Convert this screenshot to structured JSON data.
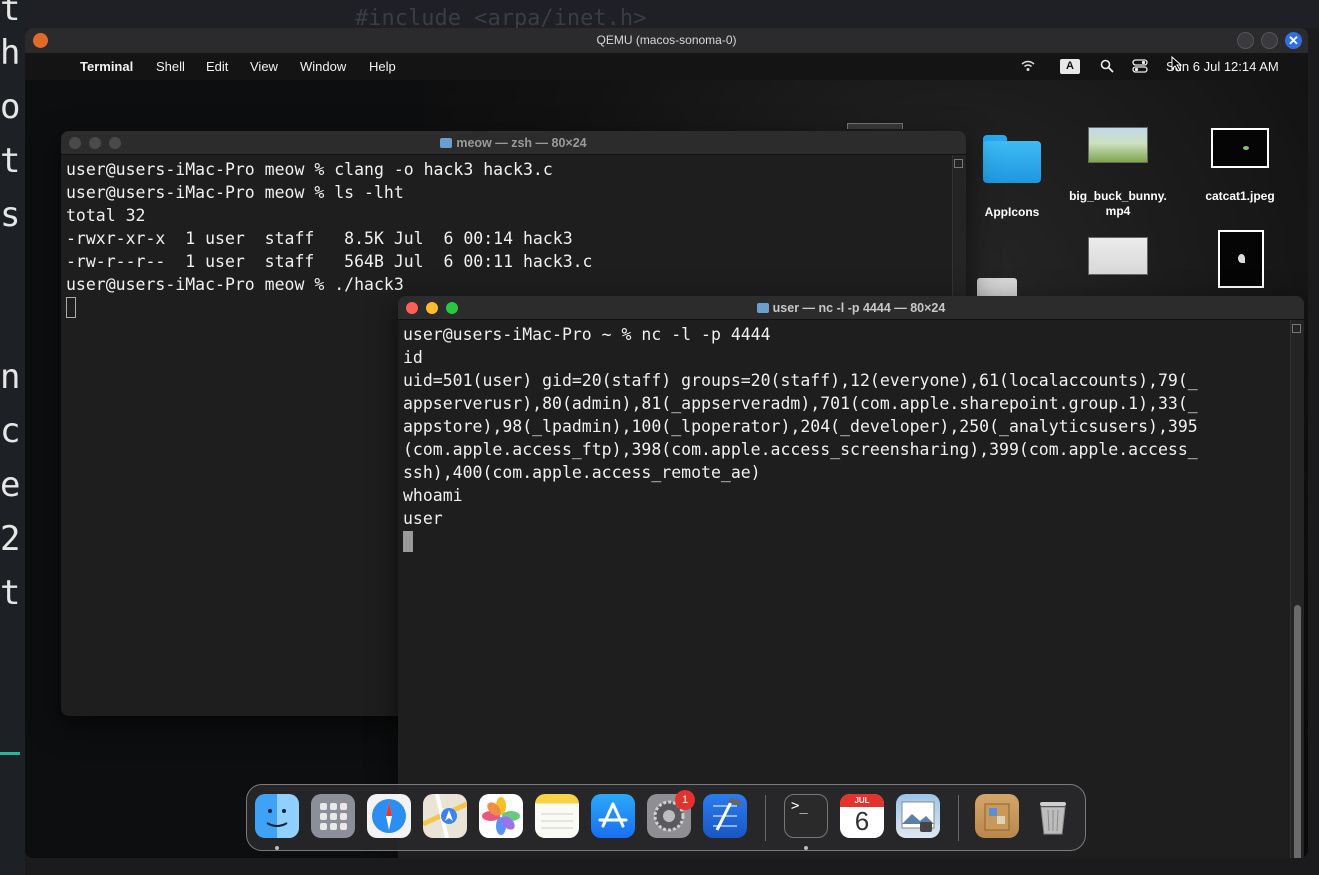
{
  "host": {
    "left_letters": [
      "t",
      "h",
      "o",
      "t",
      "s",
      "n",
      "c",
      "e",
      "2",
      "t"
    ],
    "top_code": "#include <arpa/inet.h>"
  },
  "qemu": {
    "title": "QEMU (macos-sonoma-0)",
    "close_glyph": "✕"
  },
  "menubar": {
    "apple_glyph": "",
    "app_name": "Terminal",
    "items": [
      "Shell",
      "Edit",
      "View",
      "Window",
      "Help"
    ],
    "input_source": "A",
    "clock": "Sun 6 Jul  12:14 AM"
  },
  "desktop_icons": {
    "appicons": "AppIcons",
    "video": "big_buck_bunny.\nmp4",
    "image": "catcat1.jpeg"
  },
  "term1": {
    "title": "meow — zsh — 80×24",
    "lines": [
      "user@users-iMac-Pro meow % clang -o hack3 hack3.c",
      "user@users-iMac-Pro meow % ls -lht",
      "total 32",
      "-rwxr-xr-x  1 user  staff   8.5K Jul  6 00:14 hack3",
      "-rw-r--r--  1 user  staff   564B Jul  6 00:11 hack3.c",
      "user@users-iMac-Pro meow % ./hack3"
    ]
  },
  "term2": {
    "title": "user — nc -l -p 4444 — 80×24",
    "lines": [
      "user@users-iMac-Pro ~ % nc -l -p 4444",
      "id",
      "uid=501(user) gid=20(staff) groups=20(staff),12(everyone),61(localaccounts),79(_",
      "appserverusr),80(admin),81(_appserveradm),701(com.apple.sharepoint.group.1),33(_",
      "appstore),98(_lpadmin),100(_lpoperator),204(_developer),250(_analyticsusers),395",
      "(com.apple.access_ftp),398(com.apple.access_screensharing),399(com.apple.access_",
      "ssh),400(com.apple.access_remote_ae)",
      "whoami",
      "user"
    ]
  },
  "dock": {
    "settings_badge": "1",
    "calendar_month": "JUL",
    "calendar_day": "6",
    "terminal_glyph": ">_"
  },
  "colors": {
    "accent_blue": "#2f6fe0",
    "traffic_red": "#ff5f57",
    "traffic_yellow": "#febc2e",
    "traffic_green": "#28c840"
  }
}
